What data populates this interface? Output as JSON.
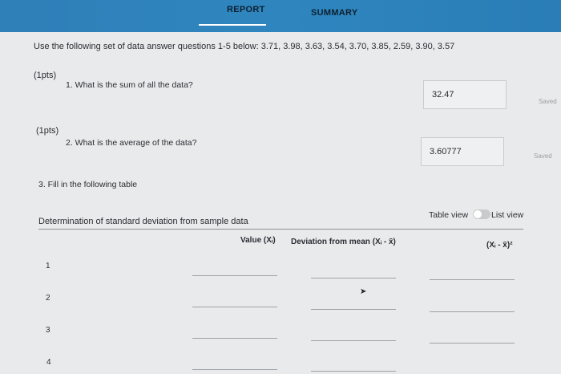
{
  "nav": {
    "tabs": [
      {
        "label": "REPORT"
      },
      {
        "label": "SUMMARY"
      }
    ]
  },
  "instructions": "Use the following set of data answer questions 1-5 below: 3.71, 3.98, 3.63, 3.54, 3.70, 3.85, 2.59, 3.90, 3.57",
  "questions": [
    {
      "points": "(1pts)",
      "text": "1. What is the sum of all the data?",
      "answer": "32.47",
      "status": "Saved"
    },
    {
      "points": "(1pts)",
      "text": "2. What is the average of the data?",
      "answer": "3.60777",
      "status": "Saved"
    }
  ],
  "table_question": "3. Fill in the following table",
  "table": {
    "title": "Determination of standard deviation from sample data",
    "view_table_label": "Table view",
    "view_list_label": "List view",
    "columns": [
      "Value (Xᵢ)",
      "Deviation from mean (Xᵢ - x̄)",
      "(Xᵢ - x̄)²"
    ],
    "rows": [
      "1",
      "2",
      "3",
      "4"
    ]
  },
  "icons": {
    "cursor": "mouse-pointer-icon"
  }
}
